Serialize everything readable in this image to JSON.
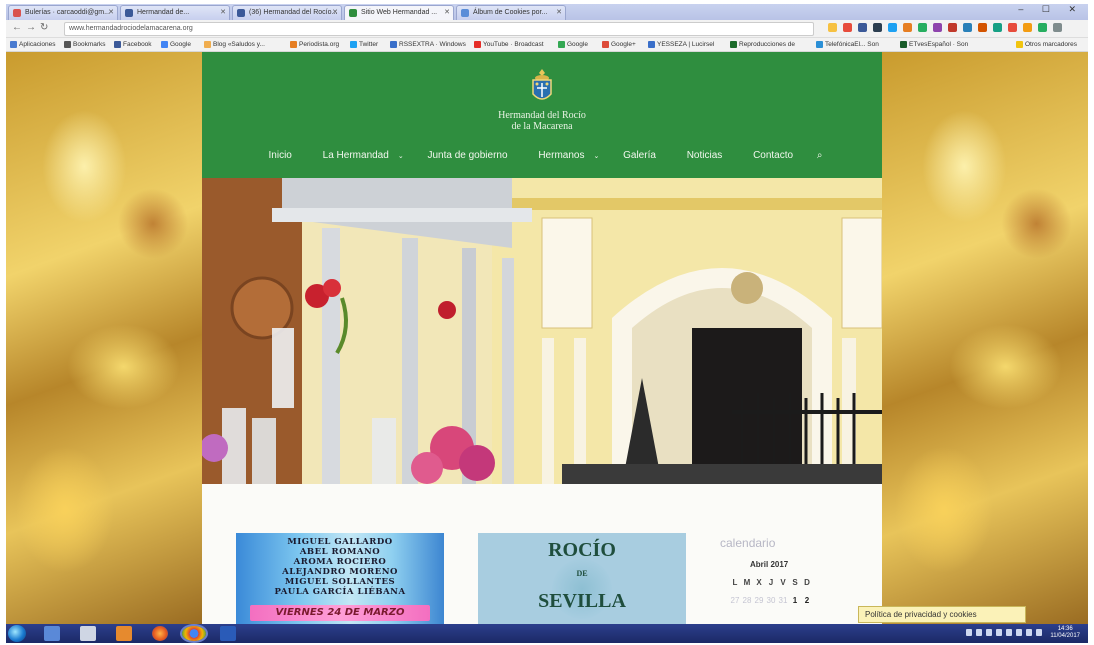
{
  "browser": {
    "tabs": [
      {
        "label": "Bulerías · carcaoddi@gm...",
        "favicon_color": "#d9534f",
        "active": false
      },
      {
        "label": "Hermandad de...",
        "favicon_color": "#3b5998",
        "active": false
      },
      {
        "label": "(36) Hermandad del Rocío...",
        "favicon_color": "#3b5998",
        "active": false
      },
      {
        "label": "Sitio Web Hermandad ...",
        "favicon_color": "#2f8e3f",
        "active": true
      },
      {
        "label": "Álbum de Cookies por...",
        "favicon_color": "#5a8dd8",
        "active": false
      }
    ],
    "window_controls": "– ☐ ✕",
    "url": "www.hermandadrociodelamacarena.org",
    "bookmarks": [
      {
        "label": "Aplicaciones",
        "color": "#4a7bd0"
      },
      {
        "label": "Bookmarks",
        "color": "#555"
      },
      {
        "label": "Facebook",
        "color": "#3b5998"
      },
      {
        "label": "Google",
        "color": "#4285f4"
      },
      {
        "label": "Blog «Saludos y...",
        "color": "#f0ad4e"
      },
      {
        "label": "Periodista.org",
        "color": "#e67e22"
      },
      {
        "label": "Twitter",
        "color": "#1da1f2"
      },
      {
        "label": "RSSEXTRA · Windows",
        "color": "#3a6fc9"
      },
      {
        "label": "YouTube · Broadcast",
        "color": "#e52d27"
      },
      {
        "label": "Google",
        "color": "#34a853"
      },
      {
        "label": "Google+",
        "color": "#dd4b39"
      },
      {
        "label": "YESSEZA | Lucirsel",
        "color": "#3a6fc9"
      },
      {
        "label": "Reproducciones de",
        "color": "#1c6b2a"
      },
      {
        "label": "TelefónicaEl... Son",
        "color": "#2b8fd6"
      },
      {
        "label": "ETvesEspañol · Son",
        "color": "#1a5d2a"
      },
      {
        "label": "Otros marcadores",
        "color": "#f1c40f"
      }
    ]
  },
  "site": {
    "name_line1": "Hermandad del Rocío",
    "name_line2": "de la Macarena",
    "nav": [
      {
        "label": "Inicio",
        "dropdown": false
      },
      {
        "label": "La Hermandad",
        "dropdown": true
      },
      {
        "label": "Junta de gobierno",
        "dropdown": false
      },
      {
        "label": "Hermanos",
        "dropdown": true
      },
      {
        "label": "Galería",
        "dropdown": false
      },
      {
        "label": "Noticias",
        "dropdown": false
      },
      {
        "label": "Contacto",
        "dropdown": false
      }
    ],
    "colors": {
      "header": "#2f8e3f",
      "nav_text": "#f2f7ee"
    }
  },
  "content": {
    "poster1": {
      "names": [
        "MIGUEL GALLARDO",
        "ABEL ROMANO",
        "AROMA ROCIERO",
        "ALEJANDRO MORENO",
        "MIGUEL SOLLANTES",
        "PAULA GARCÍA LIÉBANA"
      ],
      "date": "VIERNES 24 DE MARZO"
    },
    "poster2": {
      "title": "ROCÍO",
      "connector": "DE",
      "subtitle": "SEVILLA"
    },
    "calendar": {
      "title": "calendario",
      "month": "Abril 2017",
      "weekdays": [
        "L",
        "M",
        "X",
        "J",
        "V",
        "S",
        "D"
      ],
      "first_row": [
        "27",
        "28",
        "29",
        "30",
        "31",
        "1",
        "2"
      ]
    },
    "cookie_notice": "Política de privacidad y cookies"
  },
  "taskbar": {
    "clock_time": "14:36",
    "clock_date": "11/04/2017"
  }
}
